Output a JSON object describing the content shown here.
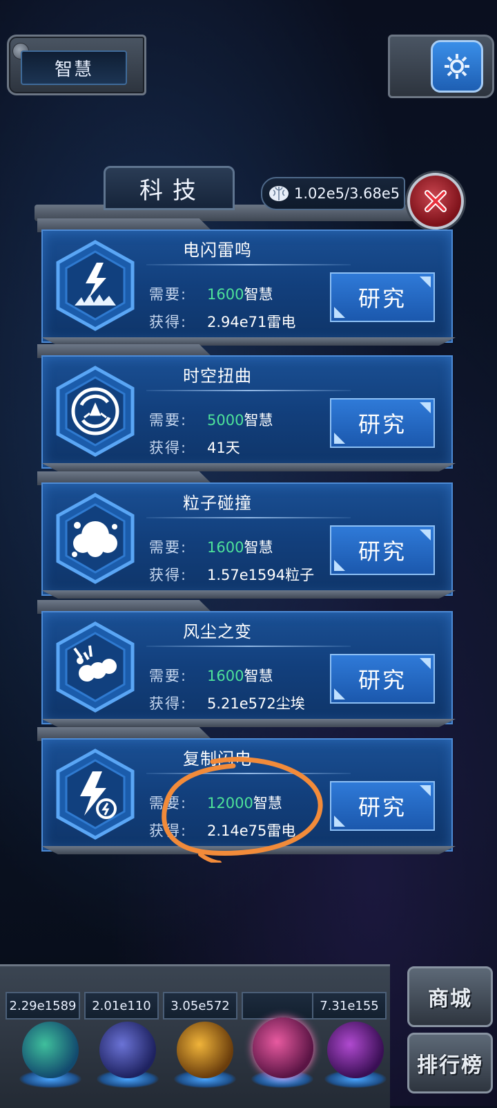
{
  "top": {
    "title": "智慧"
  },
  "modal": {
    "tab_title": "科技",
    "wisdom_counter": "1.02e5/3.68e5"
  },
  "labels": {
    "need": "需要:",
    "gain": "获得:",
    "research": "研究"
  },
  "techs": [
    {
      "name": "电闪雷鸣",
      "cost": "1600",
      "cost_unit": "智慧",
      "reward": "2.94e71雷电",
      "icon": "lightning-impact-icon"
    },
    {
      "name": "时空扭曲",
      "cost": "5000",
      "cost_unit": "智慧",
      "reward": "41天",
      "icon": "vortex-icon"
    },
    {
      "name": "粒子碰撞",
      "cost": "1600",
      "cost_unit": "智慧",
      "reward": "1.57e1594粒子",
      "icon": "particle-collision-icon"
    },
    {
      "name": "风尘之变",
      "cost": "1600",
      "cost_unit": "智慧",
      "reward": "5.21e572尘埃",
      "icon": "dust-cloud-icon"
    },
    {
      "name": "复制闪电",
      "cost": "12000",
      "cost_unit": "智慧",
      "reward": "2.14e75雷电",
      "icon": "copy-lightning-icon"
    }
  ],
  "resources": [
    {
      "value": "2.29e1589",
      "icon": "particle-orb-icon"
    },
    {
      "value": "2.01e110",
      "icon": "lightning-orb-icon"
    },
    {
      "value": "3.05e572",
      "icon": "dust-orb-icon"
    },
    {
      "value": "",
      "icon": "brain-orb-icon"
    },
    {
      "value": "7.31e155",
      "icon": "vortex-orb-icon"
    }
  ],
  "side_buttons": {
    "shop": "商城",
    "ranking": "排行榜"
  },
  "colors": {
    "accent_green": "#4ee39a",
    "panel_blue": "#1a4f93",
    "annotation_orange": "#f28b3a"
  }
}
